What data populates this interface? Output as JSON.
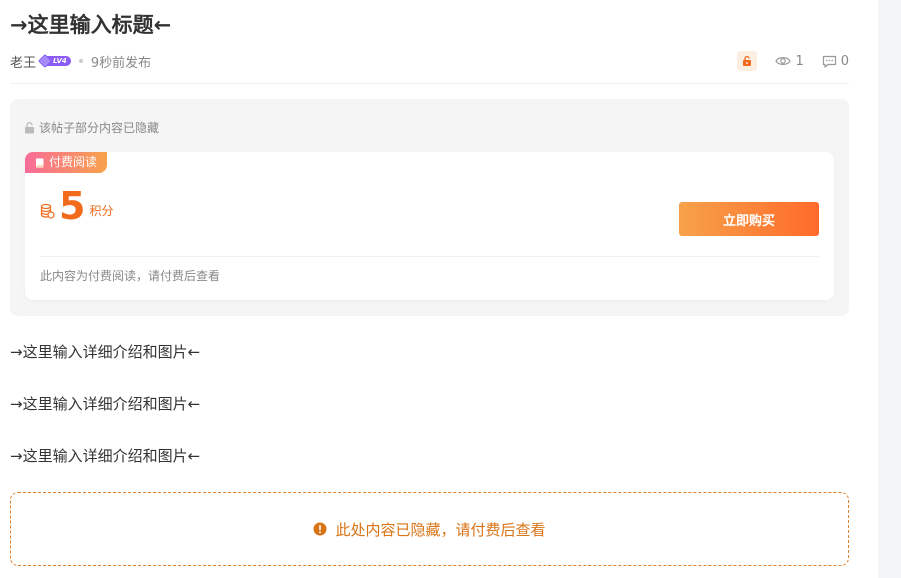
{
  "post": {
    "title": "→这里输入标题←",
    "author": "老王",
    "level": "LV4",
    "time": "9秒前发布",
    "views": "1",
    "comments": "0"
  },
  "hidden_section": {
    "note": "该帖子部分内容已隐藏",
    "tag": "付费阅读",
    "price": "5",
    "unit": "积分",
    "buy_label": "立即购买",
    "footer_note": "此内容为付费阅读，请付费后查看"
  },
  "paragraphs": [
    "→这里输入详细介绍和图片←",
    "→这里输入详细介绍和图片←",
    "→这里输入详细介绍和图片←"
  ],
  "hidden_banner": {
    "text": "此处内容已隐藏，请付费后查看"
  },
  "icons": {
    "lock": "lock-icon",
    "eye": "eye-icon",
    "comment": "comment-icon",
    "book": "book-icon",
    "coins": "coins-icon",
    "alert": "alert-icon"
  },
  "colors": {
    "accent": "#f26b1d",
    "level_badge": "#8b5cf6",
    "banner_border": "#e0822d"
  }
}
